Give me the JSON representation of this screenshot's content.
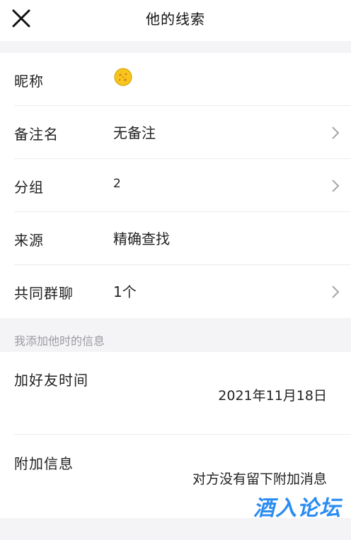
{
  "header": {
    "title": "他的线索",
    "close_icon": "close-icon"
  },
  "rows": [
    {
      "label": "昵称",
      "value": "",
      "icon": "yellow-emoji-icon",
      "chevron": false
    },
    {
      "label": "备注名",
      "value": "无备注",
      "chevron": true
    },
    {
      "label": "分组",
      "value": "2",
      "chevron": true
    },
    {
      "label": "来源",
      "value": "精确查找",
      "chevron": false
    },
    {
      "label": "共同群聊",
      "value": "1个",
      "chevron": true
    }
  ],
  "section": {
    "label": "我添加他时的信息"
  },
  "extra": [
    {
      "label": "加好友时间",
      "value": "2021年11月18日"
    },
    {
      "label": "附加信息",
      "value": "对方没有留下附加消息"
    }
  ],
  "watermark": "酒入论坛",
  "colors": {
    "background": "#f4f4f7",
    "card": "#ffffff",
    "secondary_text": "#9a9aa0",
    "watermark": "#2b8cf2"
  }
}
